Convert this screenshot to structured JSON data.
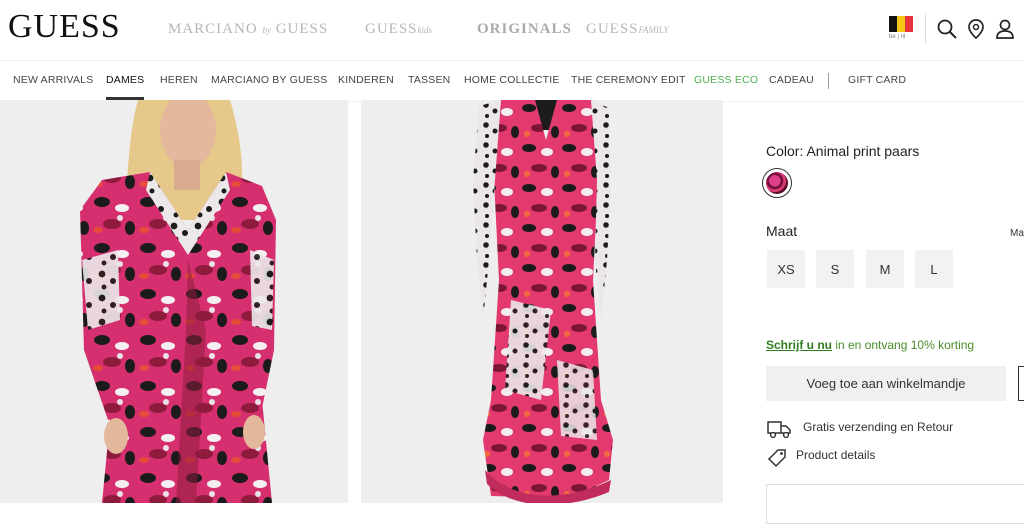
{
  "header": {
    "logo": "GUESS",
    "brands": [
      {
        "main": "MARCIANO",
        "small": "by",
        "tail": "GUESS"
      },
      {
        "main": "GUESS",
        "small": "kids"
      },
      {
        "main": "ORIGINALS"
      },
      {
        "main": "GUESS",
        "small": "FAMILY"
      }
    ],
    "locale": "be | nl",
    "flag_colors": [
      "#111111",
      "#f5c518",
      "#e8333a"
    ]
  },
  "nav": {
    "items": [
      "NEW ARRIVALS",
      "DAMES",
      "HEREN",
      "MARCIANO BY GUESS",
      "KINDEREN",
      "TASSEN",
      "HOME COLLECTIE",
      "THE CEREMONY EDIT",
      "GUESS ECO",
      "CADEAU",
      "GIFT CARD"
    ],
    "active": "DAMES",
    "eco_color": "#4caf50"
  },
  "product": {
    "color_label": "Color: Animal print paars",
    "size_label": "Maat",
    "size_guide": "Ma",
    "sizes": [
      "XS",
      "S",
      "M",
      "L"
    ],
    "promo_link": "Schrijf u nu",
    "promo_text": " in en ontvang 10% korting",
    "add_to_cart": "Voeg toe aan winkelmandje",
    "shipping": "Gratis verzending en Retour",
    "details": "Product details"
  },
  "icons": [
    "search-icon",
    "location-icon",
    "account-icon",
    "truck-icon",
    "tag-icon",
    "heart-icon"
  ]
}
